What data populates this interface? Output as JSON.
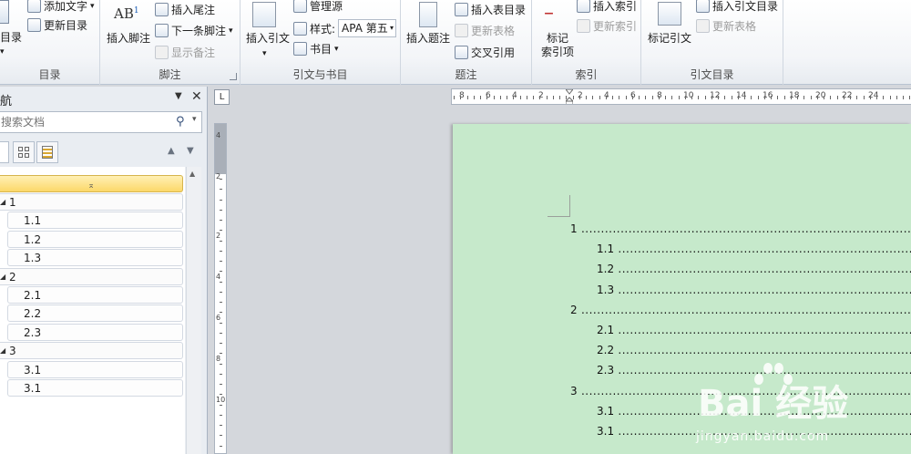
{
  "ribbon": {
    "toc_group": {
      "label": "目录",
      "toc_button_label": "目录",
      "add_text_label": "添加文字",
      "update_toc_label": "更新目录"
    },
    "footnote_group": {
      "label": "脚注",
      "insert_footnote_label": "插入脚注",
      "insert_endnote_label": "插入尾注",
      "next_footnote_label": "下一条脚注",
      "show_notes_label": "显示备注"
    },
    "citation_group": {
      "label": "引文与书目",
      "insert_citation_label": "插入引文",
      "manage_sources_label": "管理源",
      "style_label": "样式:",
      "style_value": "APA 第五",
      "bibliography_label": "书目"
    },
    "caption_group": {
      "label": "题注",
      "insert_caption_label": "插入题注",
      "insert_table_of_figures_label": "插入表目录",
      "update_table_label": "更新表格",
      "cross_reference_label": "交叉引用"
    },
    "index_group": {
      "label": "索引",
      "mark_entry_label_line1": "标记",
      "mark_entry_label_line2": "索引项",
      "insert_index_label": "插入索引",
      "update_index_label": "更新索引"
    },
    "authorities_group": {
      "label": "引文目录",
      "mark_citation_label": "标记引文",
      "insert_table_of_authorities_label": "插入引文目录",
      "update_table_label": "更新表格"
    }
  },
  "nav_pane": {
    "title": "航",
    "search_placeholder": "搜索文档",
    "headings": [
      {
        "label": "1",
        "level": 1
      },
      {
        "label": "1.1",
        "level": 2
      },
      {
        "label": "1.2",
        "level": 2
      },
      {
        "label": "1.3",
        "level": 2
      },
      {
        "label": "2",
        "level": 1
      },
      {
        "label": "2.1",
        "level": 2
      },
      {
        "label": "2.2",
        "level": 2
      },
      {
        "label": "2.3",
        "level": 2
      },
      {
        "label": "3",
        "level": 1
      },
      {
        "label": "3.1",
        "level": 2
      },
      {
        "label": "3.1",
        "level": 2
      }
    ]
  },
  "ruler": {
    "corner_symbol": "L",
    "horizontal_numbers": [
      "8",
      "6",
      "4",
      "2",
      "2",
      "4",
      "6",
      "8",
      "10",
      "12",
      "14",
      "16",
      "18",
      "20",
      "22",
      "24"
    ],
    "vertical_numbers": [
      "4",
      "2",
      "2",
      "4",
      "6",
      "8",
      "10"
    ]
  },
  "document": {
    "toc_entries": [
      {
        "number": "1",
        "level": 1
      },
      {
        "number": "1.1",
        "level": 2
      },
      {
        "number": "1.2",
        "level": 2
      },
      {
        "number": "1.3",
        "level": 2
      },
      {
        "number": "2",
        "level": 1
      },
      {
        "number": "2.1",
        "level": 2
      },
      {
        "number": "2.2",
        "level": 2
      },
      {
        "number": "2.3",
        "level": 2
      },
      {
        "number": "3",
        "level": 1
      },
      {
        "number": "3.1",
        "level": 2
      },
      {
        "number": "3.1",
        "level": 2
      }
    ]
  },
  "watermark": {
    "main": "Bai 经验",
    "sub": "jingyan.baidu.com"
  },
  "colors": {
    "page_background": "#c6e9cb",
    "selected_heading": "#fcd869",
    "ribbon_background": "#f3f5f8"
  }
}
